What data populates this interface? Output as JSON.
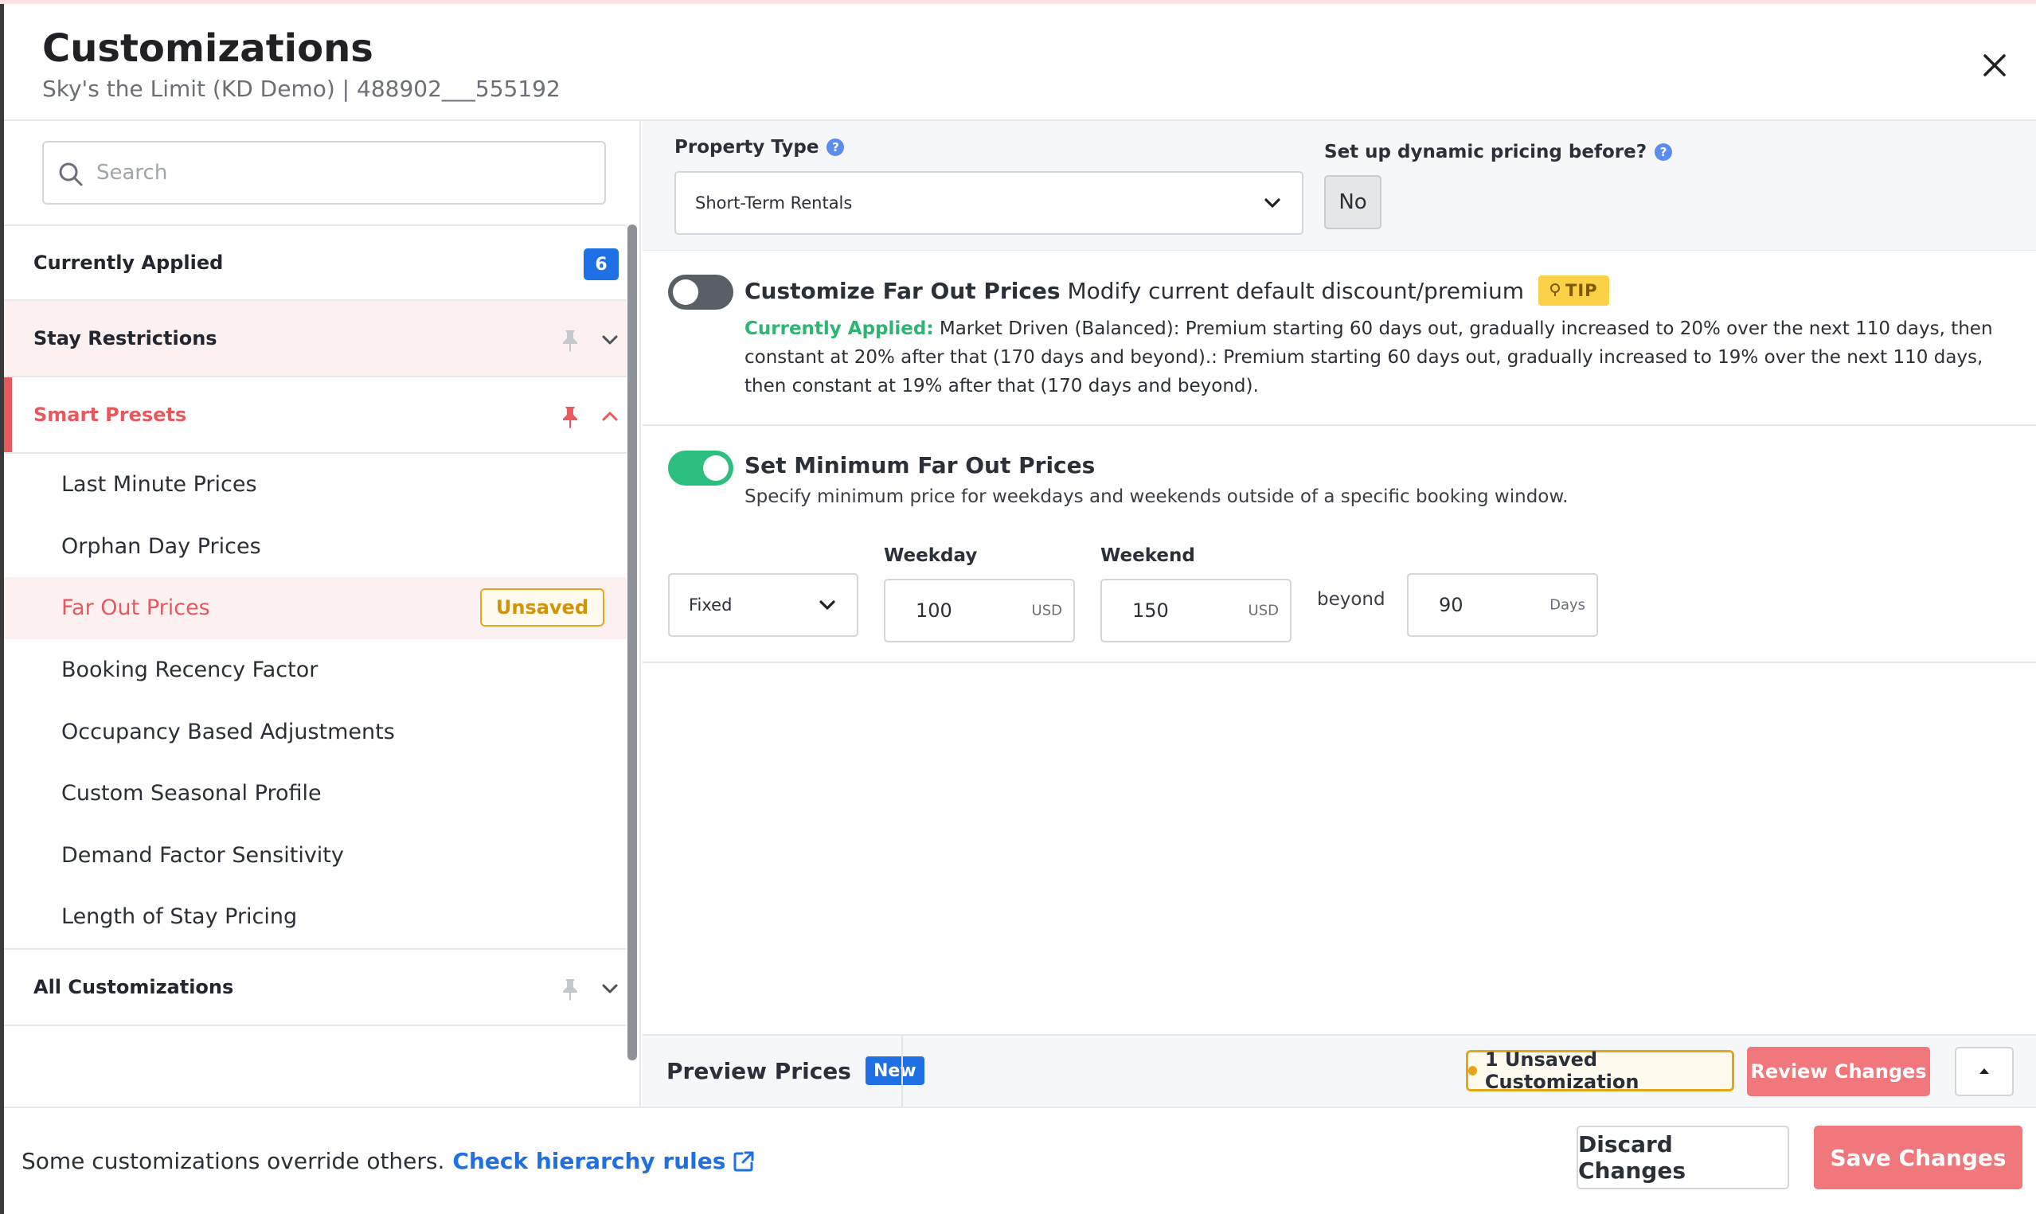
{
  "header": {
    "title": "Customizations",
    "subtitle": "Sky's the Limit (KD Demo) | 488902___555192"
  },
  "search": {
    "placeholder": "Search",
    "value": ""
  },
  "sidebar": {
    "currently_applied": {
      "label": "Currently Applied",
      "count": "6"
    },
    "stay_restrictions": {
      "label": "Stay Restrictions"
    },
    "smart_presets": {
      "label": "Smart Presets",
      "items": [
        {
          "label": "Last Minute Prices"
        },
        {
          "label": "Orphan Day Prices"
        },
        {
          "label": "Far Out Prices",
          "badge": "Unsaved"
        },
        {
          "label": "Booking Recency Factor"
        },
        {
          "label": "Occupancy Based Adjustments"
        },
        {
          "label": "Custom Seasonal Profile"
        },
        {
          "label": "Demand Factor Sensitivity"
        },
        {
          "label": "Length of Stay Pricing"
        }
      ]
    },
    "all_customizations": {
      "label": "All Customizations"
    }
  },
  "top_panel": {
    "property_type_label": "Property Type",
    "property_type_value": "Short-Term Rentals",
    "dynamic_pricing_label": "Set up dynamic pricing before?",
    "dynamic_pricing_value": "No"
  },
  "far_out": {
    "title_bold": "Customize Far Out Prices",
    "title_rest": "Modify current default discount/premium",
    "tip": "TIP",
    "applied_label": "Currently Applied:",
    "applied_text": "Market Driven (Balanced): Premium starting 60 days out, gradually increased to 20% over the next 110 days, then constant at 20% after that (170 days and beyond).: Premium starting 60 days out, gradually increased to 19% over the next 110 days, then constant at 19% after that (170 days and beyond).",
    "enabled": false
  },
  "min_far_out": {
    "title": "Set Minimum Far Out Prices",
    "description": "Specify minimum price for weekdays and weekends outside of a specific booking window.",
    "enabled": true,
    "mode": "Fixed",
    "weekday_label": "Weekday",
    "weekday_value": "100",
    "weekend_label": "Weekend",
    "weekend_value": "150",
    "currency": "USD",
    "beyond_label": "beyond",
    "days_value": "90",
    "days_unit": "Days"
  },
  "preview": {
    "title": "Preview Prices",
    "new_badge": "New",
    "unsaved_count": "1 Unsaved Customization",
    "review_label": "Review Changes"
  },
  "footer": {
    "note": "Some customizations override others.",
    "link": "Check hierarchy rules",
    "discard_label": "Discard Changes",
    "save_label": "Save Changes"
  },
  "colors": {
    "accent": "#e8585f",
    "primary_blue": "#1f6fe5",
    "toggle_on": "#2cbf7e",
    "warning": "#e5a719"
  }
}
